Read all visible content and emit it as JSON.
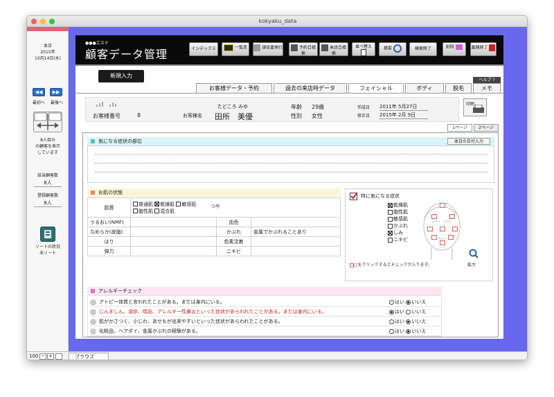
{
  "window": {
    "title": "kokyaku_data"
  },
  "colors": {
    "stage": "#6868ee",
    "accent_red": "#e25a5a",
    "allergy_red": "#c02020",
    "header_bg": "#0a0a0a",
    "concern_bg": "#d9f4f7",
    "skin_bg": "#fbf7d6",
    "allergy_bg": "#fbe6f1"
  },
  "sidebar": {
    "today_label": "本日",
    "year": "2015年",
    "date": "10月14日(水)",
    "first_label": "最初へ",
    "last_label": "最後へ",
    "nav_icon": "arrow-cross-icon",
    "display_count_1": "8人目の",
    "display_count_2": "の顧客を表示",
    "display_count_3": "しています",
    "found_label": "該当顧客数",
    "found_value": "8人",
    "registered_label": "登録顧客数",
    "registered_value": "8人",
    "sort_status_1": "ソートの状況",
    "sort_status_2": "未ソート"
  },
  "header": {
    "logo_small": "●●●エステ",
    "title": "顧客データ管理",
    "buttons": [
      {
        "label": "インデックス"
      },
      {
        "label": "一覧表"
      },
      {
        "label": "領収書発行"
      },
      {
        "label": "予約日検索"
      },
      {
        "label": "来店日検索"
      },
      {
        "label": "並べ替え"
      },
      {
        "label": "検索"
      },
      {
        "label": "検索終了"
      },
      {
        "label": "削除"
      },
      {
        "label": "業務終了"
      }
    ]
  },
  "new_entry_label": "新規入力",
  "help_label": "ヘルプ ?",
  "tabs": [
    {
      "label": "お客様データ・予約"
    },
    {
      "label": "過去の来店時データ"
    },
    {
      "label": "フェイシャル"
    },
    {
      "label": "ボディ"
    },
    {
      "label": "脱毛"
    },
    {
      "label": "メモ"
    }
  ],
  "customer": {
    "number_label": "お客様番号",
    "number": "8",
    "furigana": "たどころ みゆ",
    "name_label": "お客様名",
    "name": "田所　美優",
    "age_label": "年齢",
    "age": "29歳",
    "gender_label": "性別",
    "gender": "女性",
    "created_label": "作成日",
    "created": "2011年 5月27日",
    "modified_label": "修正日",
    "modified": "2015年 2月 9日"
  },
  "print_label": "印刷",
  "page_tabs": [
    {
      "label": "1ページ"
    },
    {
      "label": "2ページ"
    }
  ],
  "concern": {
    "title": "気になる症状の部位",
    "date_button": "本日の日付入力"
  },
  "skin": {
    "title": "お肌の状態",
    "type_label": "肌質",
    "types_row1": [
      {
        "label": "普通肌",
        "checked": false
      },
      {
        "label": "乾燥肌",
        "checked": true
      },
      {
        "label": "敏感肌",
        "checked": false
      }
    ],
    "types_row2": [
      {
        "label": "脂性肌",
        "checked": false
      },
      {
        "label": "混合肌",
        "checked": false
      }
    ],
    "gloss_label": "つや",
    "moisture_label": "うるおい(NMF)",
    "complexion_label": "血色",
    "smoothness_label": "なめらか(皮脂)",
    "rash_label": "かぶれ",
    "rash_value": "金属でかぶれることあり",
    "firmness_label": "はり",
    "pigment_label": "色素沈着",
    "elasticity_label": "弾力",
    "acne_label": "ニキビ"
  },
  "symptoms": {
    "title": "特に気になる症状",
    "items": [
      {
        "label": "乾燥肌",
        "checked": true
      },
      {
        "label": "脂性肌",
        "checked": false
      },
      {
        "label": "敏感肌",
        "checked": false
      },
      {
        "label": "かぶれ",
        "checked": false
      },
      {
        "label": "しみ",
        "checked": true
      },
      {
        "label": "ニキビ",
        "checked": false
      }
    ],
    "note": "□をクリックするとチェックが入ります。",
    "zoom_label": "拡大"
  },
  "allergy": {
    "title": "アレルギーチェック",
    "yes_label": "はい",
    "no_label": "いいえ",
    "questions": [
      {
        "text": "アトピー体質と言われたことがある。または身内にいる。",
        "answer": "no",
        "highlight": false
      },
      {
        "text": "じんましん、湿疹、喘息、アレルギー性鼻炎といった症状があらわれたことがある。または身内にいる。",
        "answer": "yes",
        "highlight": true
      },
      {
        "text": "肌がかさつく、小じわ、あせもが出来やすいといった症状があらわれたことがある。",
        "answer": "no",
        "highlight": false
      },
      {
        "text": "化粧品、ヘアダイ、金属かぶれの経験がある。",
        "answer": "no",
        "highlight": false
      }
    ]
  },
  "statusbar": {
    "zoom": "100",
    "mode": "ブラウズ"
  }
}
